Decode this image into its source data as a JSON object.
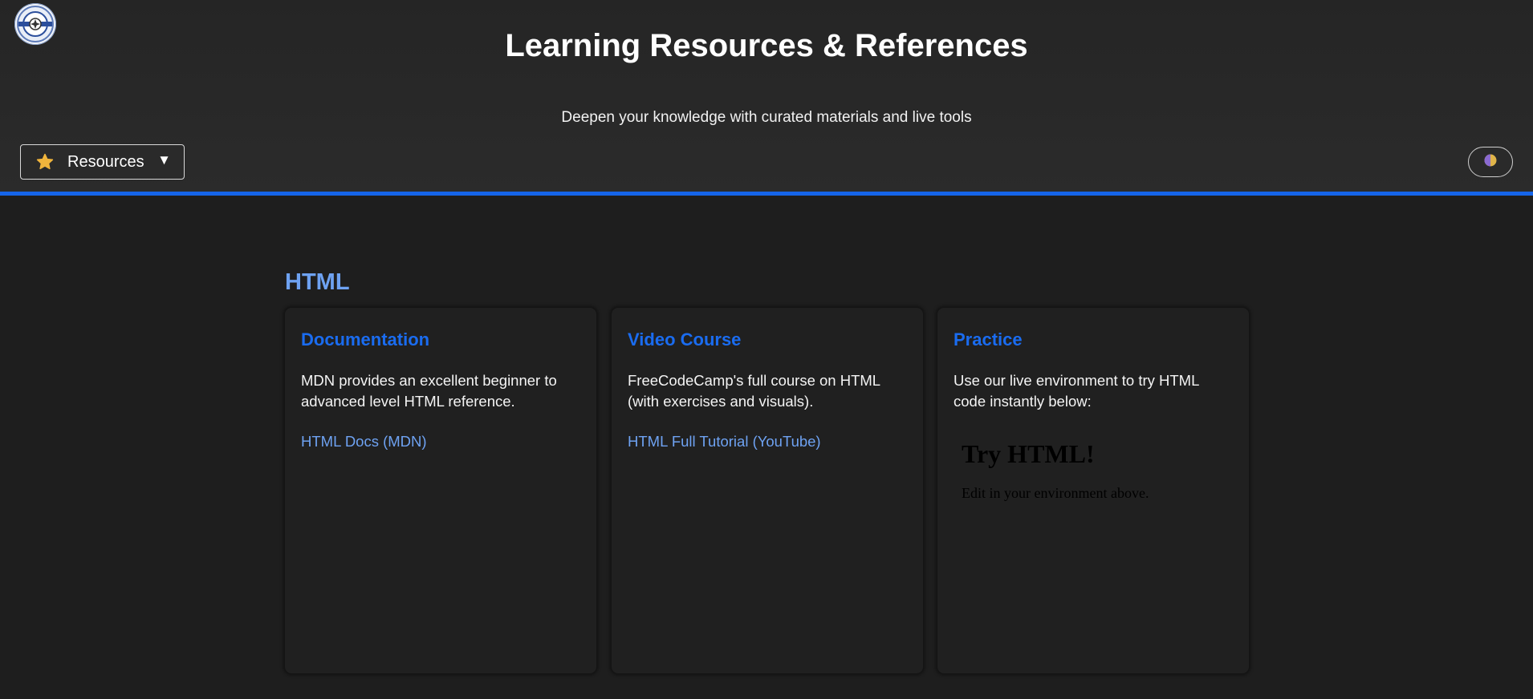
{
  "header": {
    "title": "Learning Resources & References",
    "subtitle": "Deepen your knowledge with curated materials and live tools",
    "logo_icon": "badge-logo-icon"
  },
  "nav": {
    "dropdown_label": "Resources",
    "dropdown_icon": "star-icon",
    "caret": "▼",
    "theme_toggle_icon": "contrast-icon"
  },
  "colors": {
    "accent": "#1565ea",
    "link": "#6ea2f2",
    "card_heading": "#1a6cf0",
    "star": "#f0b43c"
  },
  "section": {
    "title": "HTML",
    "cards": [
      {
        "heading": "Documentation",
        "text": "MDN provides an excellent beginner to advanced level HTML reference.",
        "link": "HTML Docs (MDN)"
      },
      {
        "heading": "Video Course",
        "text": "FreeCodeCamp's full course on HTML (with exercises and visuals).",
        "link": "HTML Full Tutorial (YouTube)"
      },
      {
        "heading": "Practice",
        "text": "Use our live environment to try HTML code instantly below:",
        "preview_heading": "Try HTML!",
        "preview_text": "Edit in your environment above."
      }
    ]
  }
}
